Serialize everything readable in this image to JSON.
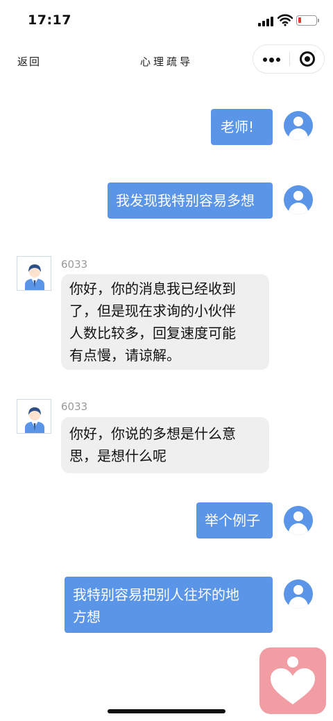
{
  "status_bar": {
    "time": "17:17",
    "battery_color": "#e53935",
    "icons": [
      "signal-icon",
      "wifi-icon",
      "battery-icon"
    ]
  },
  "nav": {
    "back_label": "返回",
    "title": "心理疏导",
    "more_icon": "more-dots-icon",
    "close_icon": "target-icon"
  },
  "messages": [
    {
      "from": "me",
      "text": "老师!"
    },
    {
      "from": "me",
      "text": "我发现我特别容易多想"
    },
    {
      "from": "other",
      "sender": "6033",
      "text": "你好，你的消息我已经收到了，但是现在求询的小伙伴人数比较多，回复速度可能有点慢，请谅解。",
      "lines": [
        "你好，你的消息我已经收到",
        "了，但是现在求询的小伙伴",
        "人数比较多，回复速度可能",
        "有点慢，请谅解。"
      ]
    },
    {
      "from": "other",
      "sender": "6033",
      "text": "你好，你说的多想是什么意思，是想什么呢",
      "lines": [
        "你好，你说的多想是什么意",
        "思，是想什么呢"
      ]
    },
    {
      "from": "me",
      "text": "举个例子"
    },
    {
      "from": "me",
      "text": "我特别容易把别人往坏的地方想",
      "lines": [
        "我特别容易把别人往坏的地",
        "方想"
      ]
    }
  ],
  "float_button": {
    "icon": "heart-person-icon"
  },
  "colors": {
    "my_bubble": "#5b95e8",
    "other_bubble": "#efefef",
    "float_button": "#f29da3"
  }
}
